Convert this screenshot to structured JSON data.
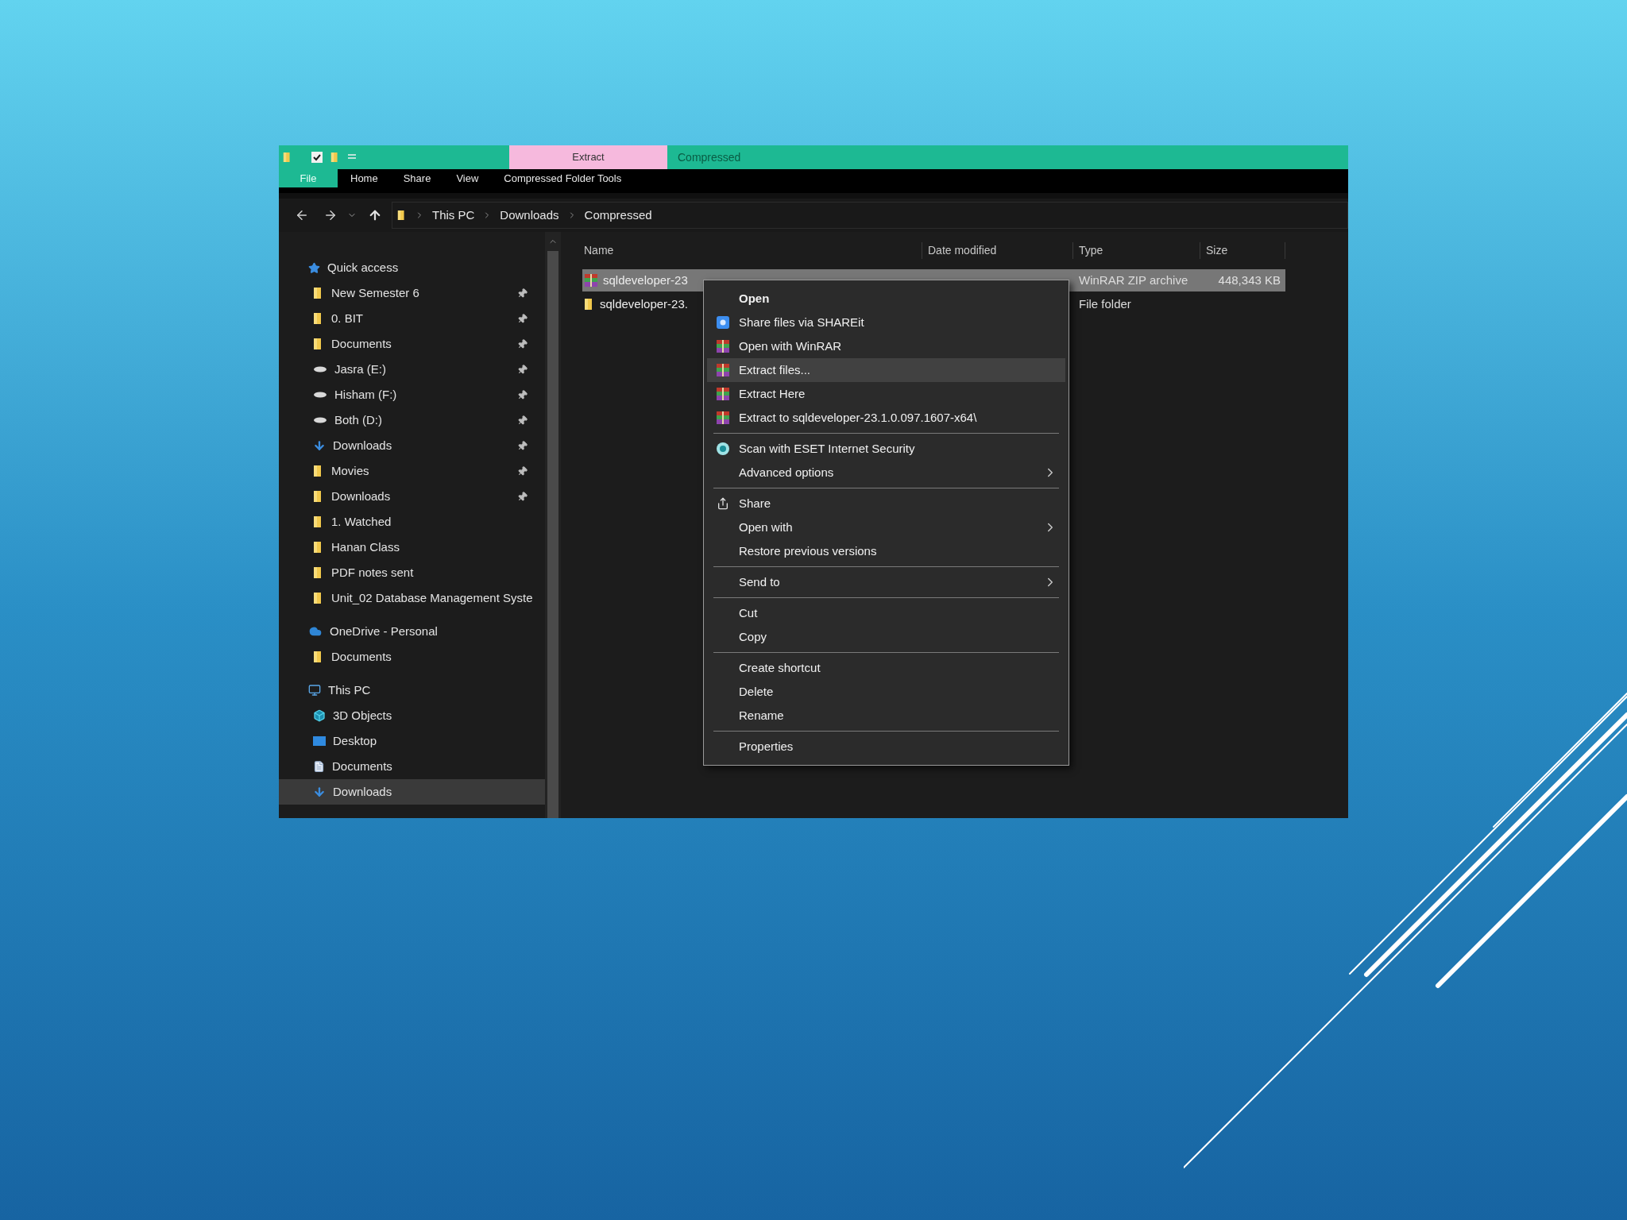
{
  "title_bar": {
    "context_tab": "Extract",
    "context_title": "Compressed"
  },
  "ribbon_tabs": [
    {
      "label": "File",
      "kind": "file"
    },
    {
      "label": "Home",
      "kind": "tab"
    },
    {
      "label": "Share",
      "kind": "tab"
    },
    {
      "label": "View",
      "kind": "tab"
    },
    {
      "label": "Compressed Folder Tools",
      "kind": "tab"
    }
  ],
  "address": {
    "path": [
      "This PC",
      "Downloads",
      "Compressed"
    ]
  },
  "sidebar": {
    "sections": [
      {
        "label": "Quick access",
        "kind": "star",
        "selected": false,
        "children": [
          {
            "label": "New Semester 6",
            "kind": "folder",
            "pinned": true,
            "selected": false
          },
          {
            "label": "0. BIT",
            "kind": "folder",
            "pinned": true,
            "selected": false
          },
          {
            "label": "Documents",
            "kind": "folder",
            "pinned": true,
            "selected": false
          },
          {
            "label": "Jasra (E:)",
            "kind": "drive",
            "pinned": true,
            "selected": false
          },
          {
            "label": "Hisham (F:)",
            "kind": "drive",
            "pinned": true,
            "selected": false
          },
          {
            "label": "Both (D:)",
            "kind": "drive",
            "pinned": true,
            "selected": false
          },
          {
            "label": "Downloads",
            "kind": "download",
            "pinned": true,
            "selected": false
          },
          {
            "label": "Movies",
            "kind": "folder",
            "pinned": true,
            "selected": false
          },
          {
            "label": "Downloads",
            "kind": "folder",
            "pinned": true,
            "selected": false
          },
          {
            "label": "1. Watched",
            "kind": "folder",
            "pinned": false,
            "selected": false
          },
          {
            "label": "Hanan Class",
            "kind": "folder",
            "pinned": false,
            "selected": false
          },
          {
            "label": "PDF notes sent",
            "kind": "folder",
            "pinned": false,
            "selected": false
          },
          {
            "label": "Unit_02 Database Management Syste",
            "kind": "folder",
            "pinned": false,
            "selected": false
          }
        ]
      },
      {
        "label": "OneDrive - Personal",
        "kind": "cloud",
        "selected": false,
        "children": [
          {
            "label": "Documents",
            "kind": "folder",
            "pinned": false,
            "selected": false
          }
        ]
      },
      {
        "label": "This PC",
        "kind": "pc",
        "selected": false,
        "children": [
          {
            "label": "3D Objects",
            "kind": "cube",
            "pinned": false,
            "selected": false
          },
          {
            "label": "Desktop",
            "kind": "desktop",
            "pinned": false,
            "selected": false
          },
          {
            "label": "Documents",
            "kind": "document",
            "pinned": false,
            "selected": false
          },
          {
            "label": "Downloads",
            "kind": "download",
            "pinned": false,
            "selected": true
          }
        ]
      }
    ]
  },
  "file_list": {
    "columns": [
      "Name",
      "Date modified",
      "Type",
      "Size"
    ],
    "rows": [
      {
        "name": "sqldeveloper-23",
        "kind": "archive",
        "type": "WinRAR ZIP archive",
        "size": "448,343 KB",
        "selected": true
      },
      {
        "name": "sqldeveloper-23.",
        "kind": "folder",
        "type": "File folder",
        "selected": false
      }
    ]
  },
  "context_menu": {
    "groups": [
      {
        "items": [
          {
            "label": "Open",
            "default": true,
            "selected": false,
            "submenu": false
          },
          {
            "label": "Share files via SHAREit",
            "kind": "shareit",
            "default": false,
            "selected": false,
            "submenu": false
          },
          {
            "label": "Open with WinRAR",
            "kind": "winrar",
            "default": false,
            "selected": false,
            "submenu": false
          },
          {
            "label": "Extract files...",
            "kind": "winrar",
            "default": false,
            "selected": true,
            "submenu": false
          },
          {
            "label": "Extract Here",
            "kind": "winrar",
            "default": false,
            "selected": false,
            "submenu": false
          },
          {
            "label": "Extract to sqldeveloper-23.1.0.097.1607-x64\\",
            "kind": "winrar",
            "default": false,
            "selected": false,
            "submenu": false
          }
        ]
      },
      {
        "items": [
          {
            "label": "Scan with ESET Internet Security",
            "kind": "eset",
            "default": false,
            "selected": false,
            "submenu": false
          },
          {
            "label": "Advanced options",
            "default": false,
            "selected": false,
            "submenu": true
          }
        ]
      },
      {
        "items": [
          {
            "label": "Share",
            "kind": "share",
            "default": false,
            "selected": false,
            "submenu": false
          },
          {
            "label": "Open with",
            "default": false,
            "selected": false,
            "submenu": true
          },
          {
            "label": "Restore previous versions",
            "default": false,
            "selected": false,
            "submenu": false
          }
        ]
      },
      {
        "items": [
          {
            "label": "Send to",
            "default": false,
            "selected": false,
            "submenu": true
          }
        ]
      },
      {
        "items": [
          {
            "label": "Cut",
            "default": false,
            "selected": false,
            "submenu": false
          },
          {
            "label": "Copy",
            "default": false,
            "selected": false,
            "submenu": false
          }
        ]
      },
      {
        "items": [
          {
            "label": "Create shortcut",
            "default": false,
            "selected": false,
            "submenu": false
          },
          {
            "label": "Delete",
            "default": false,
            "selected": false,
            "submenu": false
          },
          {
            "label": "Rename",
            "default": false,
            "selected": false,
            "submenu": false
          }
        ]
      },
      {
        "items": [
          {
            "label": "Properties",
            "default": false,
            "selected": false,
            "submenu": false
          }
        ]
      }
    ]
  }
}
